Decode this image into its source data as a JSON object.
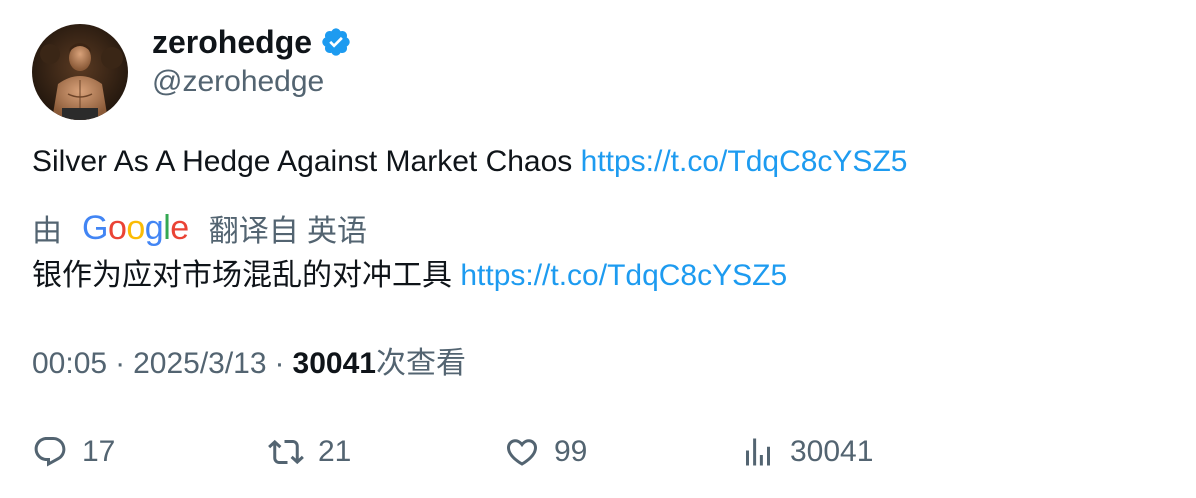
{
  "author": {
    "display_name": "zerohedge",
    "handle": "@zerohedge",
    "verified": true,
    "verified_badge_color": "#1d9bf0"
  },
  "tweet": {
    "text": "Silver As A Hedge Against Market Chaos",
    "link": "https://t.co/TdqC8cYSZ5"
  },
  "translation": {
    "by_label": "由",
    "provider_logo_text": "Google",
    "from_label": "翻译自 英语",
    "text": "银作为应对市场混乱的对冲工具",
    "link": "https://t.co/TdqC8cYSZ5"
  },
  "meta": {
    "time": "00:05",
    "separator": "·",
    "date": "2025/3/13",
    "views_count": "30041",
    "views_label": "次查看"
  },
  "actions": {
    "reply_count": "17",
    "retweet_count": "21",
    "like_count": "99",
    "views_count": "30041"
  },
  "colors": {
    "text": "#0f1419",
    "secondary": "#536471",
    "link": "#1d9bf0",
    "google_blue": "#4285F4",
    "google_red": "#EA4335",
    "google_yellow": "#FBBC05",
    "google_green": "#34A853"
  }
}
